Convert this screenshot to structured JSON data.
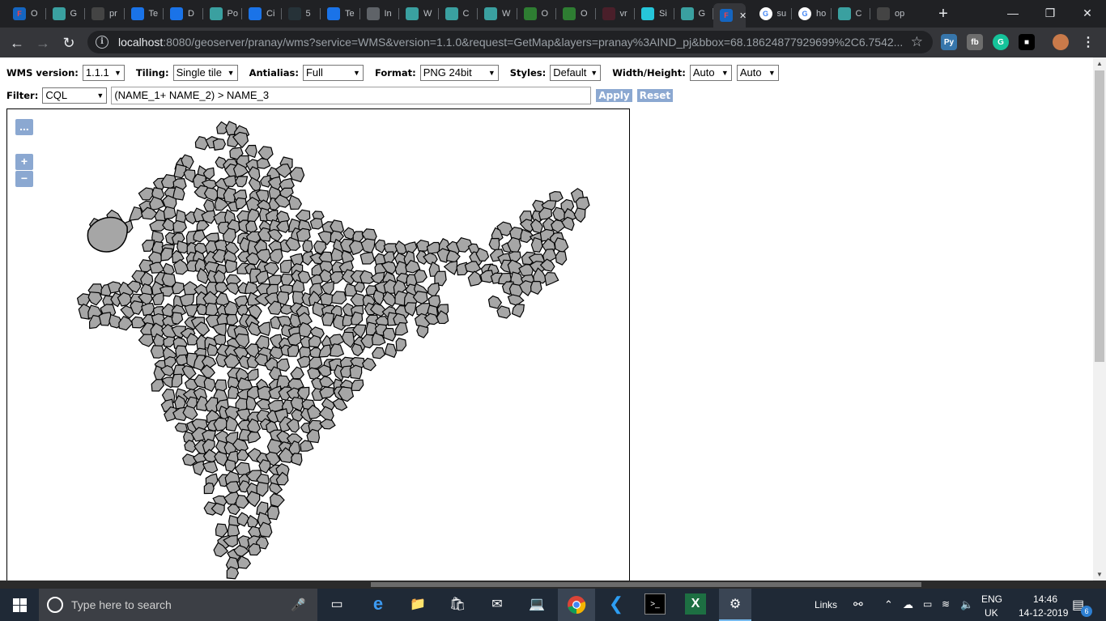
{
  "browser": {
    "tabs": [
      {
        "label": "O",
        "favicon": "geoserver-icon",
        "color": "#1565c0"
      },
      {
        "label": "G",
        "favicon": "geo-icon",
        "color": "#3aa0a0"
      },
      {
        "label": "pr",
        "favicon": "github-icon",
        "color": "#444"
      },
      {
        "label": "Te",
        "favicon": "gear-icon",
        "color": "#1a73e8"
      },
      {
        "label": "D",
        "favicon": "gear-icon",
        "color": "#1a73e8"
      },
      {
        "label": "Po",
        "favicon": "geo-icon",
        "color": "#3aa0a0"
      },
      {
        "label": "Ci",
        "favicon": "circle-icon",
        "color": "#1a73e8"
      },
      {
        "label": "5",
        "favicon": "dot-icon",
        "color": "#263238"
      },
      {
        "label": "Te",
        "favicon": "gear-icon",
        "color": "#1a73e8"
      },
      {
        "label": "In",
        "favicon": "globe-icon",
        "color": "#5f6368"
      },
      {
        "label": "W",
        "favicon": "geo-icon",
        "color": "#3aa0a0"
      },
      {
        "label": "C",
        "favicon": "geo-icon",
        "color": "#3aa0a0"
      },
      {
        "label": "W",
        "favicon": "geo-icon",
        "color": "#3aa0a0"
      },
      {
        "label": "O",
        "favicon": "spinner-icon",
        "color": "#2e7d32"
      },
      {
        "label": "O",
        "favicon": "spinner-icon",
        "color": "#2e7d32"
      },
      {
        "label": "vr",
        "favicon": "square-icon",
        "color": "#4a1f2a"
      },
      {
        "label": "Si",
        "favicon": "diamond-icon",
        "color": "#26c6da"
      },
      {
        "label": "G",
        "favicon": "geo-icon",
        "color": "#3aa0a0"
      },
      {
        "label": "",
        "favicon": "geoserver-icon",
        "color": "#1565c0",
        "active": true
      },
      {
        "label": "su",
        "favicon": "google-icon",
        "color": "#fff"
      },
      {
        "label": "ho",
        "favicon": "google-icon",
        "color": "#fff"
      },
      {
        "label": "C",
        "favicon": "geo-icon",
        "color": "#3aa0a0"
      },
      {
        "label": "op",
        "favicon": "github-icon",
        "color": "#444"
      }
    ],
    "url_host": "localhost",
    "url_rest": ":8080/geoserver/pranay/wms?service=WMS&version=1.1.0&request=GetMap&layers=pranay%3AIND_pj&bbox=68.18624877929699%2C6.7542..."
  },
  "controls": {
    "wms_version_label": "WMS version:",
    "wms_version_value": "1.1.1",
    "tiling_label": "Tiling:",
    "tiling_value": "Single tile",
    "antialias_label": "Antialias:",
    "antialias_value": "Full",
    "format_label": "Format:",
    "format_value": "PNG 24bit",
    "styles_label": "Styles:",
    "styles_value": "Default",
    "wh_label": "Width/Height:",
    "width_value": "Auto",
    "height_value": "Auto",
    "filter_label": "Filter:",
    "filter_type": "CQL",
    "filter_expression": "(NAME_1+ NAME_2) > NAME_3",
    "apply_label": "Apply",
    "reset_label": "Reset"
  },
  "map": {
    "toolbar_toggle": "...",
    "zoom_in": "+",
    "zoom_out": "−",
    "fill_color": "#a6a6a6",
    "stroke_color": "#000000"
  },
  "taskbar": {
    "search_placeholder": "Type here to search",
    "links_label": "Links",
    "lang_top": "ENG",
    "lang_bottom": "UK",
    "time": "14:46",
    "date": "14-12-2019",
    "notification_count": "6"
  }
}
